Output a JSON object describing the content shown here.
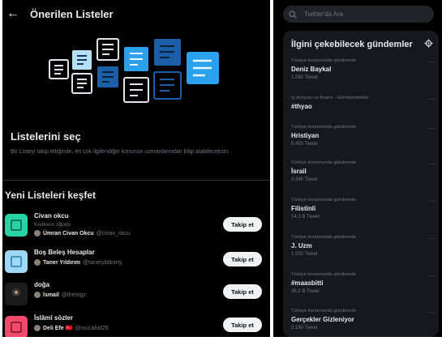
{
  "header": {
    "back_glyph": "←",
    "title": "Önerilen Listeler"
  },
  "choose": {
    "title": "Listelerini seç",
    "description": "Bir Listeyi takip ettiğinde, en çok ilgilendiğin konunun uzmanlarından bilgi alabileceksin."
  },
  "discover": {
    "title": "Yeni Listeleri keşfet"
  },
  "lists": [
    {
      "name": "Civan okcu",
      "subtitle": "Kedilerin öğüdü",
      "owner_name": "Ümran Civan Okcu",
      "owner_handle": "@civan_okcu",
      "follow_label": "Takip et",
      "thumb_color": "#28d3a3"
    },
    {
      "name": "Boş Beleş Hesaplar",
      "subtitle": "",
      "owner_name": "Taner Yıldırım",
      "owner_handle": "@taneryildirimy",
      "follow_label": "Takip et",
      "thumb_color": "#9fd8f2"
    },
    {
      "name": "doğa",
      "subtitle": "",
      "owner_name": "İsmail",
      "owner_handle": "@thetngz",
      "follow_label": "Takip et",
      "thumb_color": "#1c1c1c"
    },
    {
      "name": "İslâmî sözler",
      "subtitle": "",
      "owner_name": "Deli Efe 🇹🇷",
      "owner_handle": "@mucahid25",
      "follow_label": "Takip et",
      "thumb_color": "#f24a6a"
    }
  ],
  "search": {
    "placeholder": "Twitter'da Ara",
    "value": ""
  },
  "trends": {
    "title": "İlgini çekebilecek gündemler",
    "items": [
      {
        "context": "Türkiye konumunda gündemde",
        "name": "Deniz Baykal",
        "count": "1.590 Tweet"
      },
      {
        "context": "İş dünyası ve finans · Gündemdekiler",
        "name": "#thyao",
        "count": ""
      },
      {
        "context": "Türkiye konumunda gündemde",
        "name": "Hristiyan",
        "count": "5.450 Tweet"
      },
      {
        "context": "Türkiye konumunda gündemde",
        "name": "İsrail",
        "count": "3.346 Tweet"
      },
      {
        "context": "Türkiye konumunda gündemde",
        "name": "Filistinli",
        "count": "14,3 B Tweet"
      },
      {
        "context": "Türkiye konumunda gündemde",
        "name": "J. Uzm",
        "count": "1.550 Tweet"
      },
      {
        "context": "Türkiye konumunda gündemde",
        "name": "#maasbitti",
        "count": "38,2 B Tweet"
      },
      {
        "context": "Türkiye konumunda gündemde",
        "name": "Gerçekler Gizleniyor",
        "count": "2.190 Tweet"
      }
    ],
    "more_glyph": "···"
  },
  "colors": {
    "accent": "#1d9bf0",
    "background": "#000000",
    "panel": "#16181c"
  }
}
